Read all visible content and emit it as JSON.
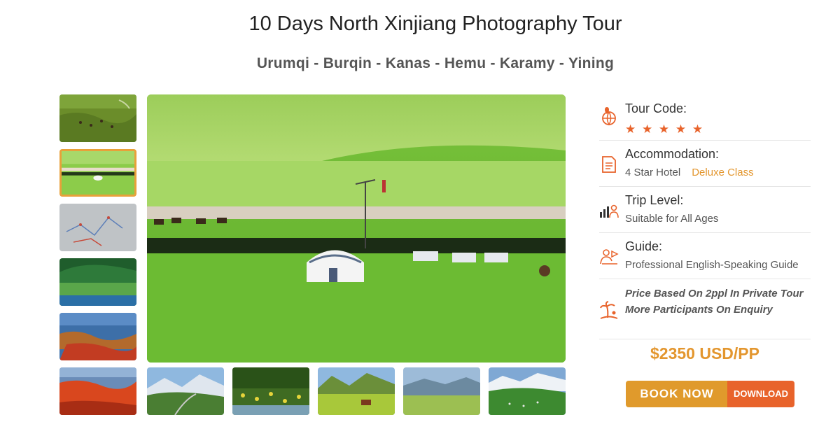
{
  "page": {
    "title": "10 Days North Xinjiang Photography Tour",
    "route": "Urumqi - Burqin - Kanas - Hemu - Karamy - Yining"
  },
  "gallery": {
    "vertical_thumbs": [
      "meadow-herd",
      "yurt-grassland",
      "route-map",
      "forest-lake",
      "rocky-coast",
      "red-flowers-shore"
    ],
    "active_thumb_index": 1,
    "bottom_thumbs": [
      "mountain-road",
      "flower-valley",
      "horse-pasture",
      "grassland-peaks",
      "snowy-ridge-meadow"
    ],
    "main_image": "yurt-on-grassland-with-windmill"
  },
  "info": {
    "tour_code_label": "Tour Code:",
    "rating": 5,
    "stars": "★ ★ ★ ★ ★",
    "accommodation_label": "Accommodation:",
    "accommodation_value": "4 Star Hotel",
    "accommodation_class": "Deluxe Class",
    "trip_level_label": "Trip Level:",
    "trip_level_value": "Suitable for All Ages",
    "guide_label": "Guide:",
    "guide_value": "Professional English-Speaking Guide",
    "price_note_line1": "Price Based On 2ppl In Private Tour",
    "price_note_line2": "More Participants On Enquiry"
  },
  "price": "$2350 USD/PP",
  "buttons": {
    "book": "BOOK NOW",
    "download": "DOWNLOAD"
  },
  "colors": {
    "accent_orange": "#e3962e",
    "accent_red": "#e8632b",
    "icon_orange": "#e8632b"
  },
  "icons": [
    "globe-pin-icon",
    "document-icon",
    "bar-people-icon",
    "guide-person-icon",
    "palm-beach-icon",
    "star-icon"
  ]
}
